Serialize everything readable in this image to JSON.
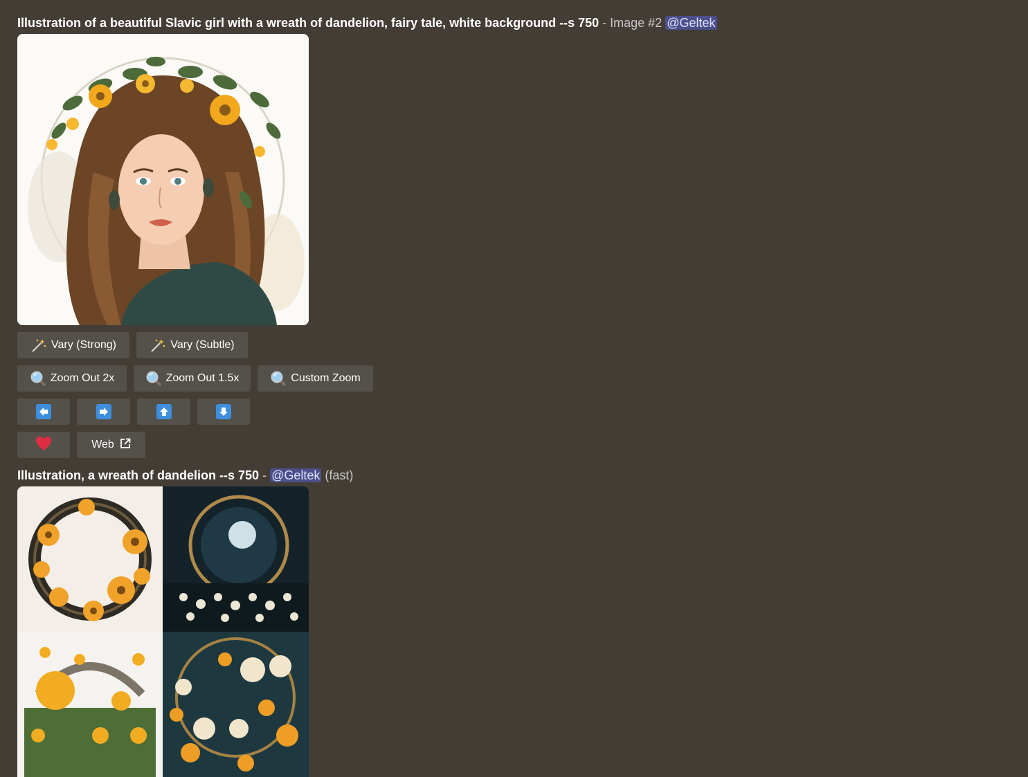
{
  "message1": {
    "prompt": "Illustration of a beautiful Slavic girl with a wreath of dandelion, fairy tale, white background --s 750",
    "separator": " - ",
    "image_label": "Image #2",
    "mention": "@Geltek"
  },
  "buttons": {
    "vary_strong": "Vary (Strong)",
    "vary_subtle": "Vary (Subtle)",
    "zoom_out_2x": "Zoom Out 2x",
    "zoom_out_15x": "Zoom Out 1.5x",
    "custom_zoom": "Custom Zoom",
    "web": "Web"
  },
  "icons": {
    "vary": "sparkles-icon",
    "zoom": "magnifier-icon",
    "pan": [
      "arrow-left-icon",
      "arrow-right-icon",
      "arrow-up-icon",
      "arrow-down-icon"
    ],
    "favorite": "heart-icon",
    "external": "external-link-icon"
  },
  "message2": {
    "prompt": "Illustration, a wreath of dandelion --s 750",
    "separator": " - ",
    "mention": "@Geltek",
    "mode": "(fast)"
  },
  "colors": {
    "background": "#433d36",
    "button": "#54504a",
    "accent_blue": "#3d8fde",
    "heart_red": "#dd2e44",
    "mention_bg": "#5865f2"
  }
}
